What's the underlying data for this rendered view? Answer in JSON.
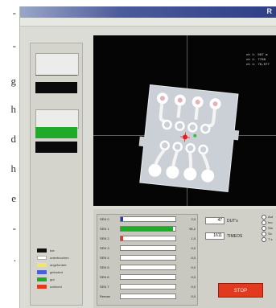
{
  "side_text": [
    "-",
    "-",
    "g",
    "h",
    "d",
    "h",
    "e",
    "-",
    "."
  ],
  "window": {
    "title": "R"
  },
  "colors": {
    "title_gradient_start": "#9aa6c8",
    "title_gradient_end": "#2f3f86",
    "camera_bg": "#050505",
    "chip_body": "#cbd0d6",
    "pad": "#ffffff",
    "accent_green": "#1faa2a",
    "stop_red": "#e23a1e"
  },
  "camera": {
    "overlay_lines": [
      "ch 1: 097 m",
      "ch 1: 7768",
      "ch 1: 76,077"
    ]
  },
  "legend": [
    {
      "label": "bar",
      "color": "#111111"
    },
    {
      "label": "unterbrochen",
      "color": "#ffffff"
    },
    {
      "label": "angefordert",
      "color": "#f2e66a"
    },
    {
      "label": "gefordert",
      "color": "#4a5fd0"
    },
    {
      "label": "gut",
      "color": "#1faa2a"
    },
    {
      "label": "schlecht",
      "color": "#e23a1e"
    }
  ],
  "channels": [
    {
      "label": "SEN 0",
      "value": "2,0",
      "level": 0.02,
      "color": "#2a3c9c"
    },
    {
      "label": "SEN 1",
      "value": "96,2",
      "level": 0.96,
      "color": "#1faa2a"
    },
    {
      "label": "SEN 2",
      "value": "1,0",
      "level": 0.01,
      "color": "#e23a1e"
    },
    {
      "label": "SEN 3",
      "value": "0,0",
      "level": 0.0,
      "color": "#2a3c9c"
    },
    {
      "label": "SEN 4",
      "value": "0,0",
      "level": 0.0,
      "color": "#2a3c9c"
    },
    {
      "label": "SEN 5",
      "value": "0,0",
      "level": 0.0,
      "color": "#2a3c9c"
    },
    {
      "label": "SEN 6",
      "value": "0,0",
      "level": 0.0,
      "color": "#2a3c9c"
    },
    {
      "label": "SEN 7",
      "value": "0,0",
      "level": 0.0,
      "color": "#2a3c9c"
    },
    {
      "label": "Reman",
      "value": "0,0",
      "level": 0.0,
      "color": "#2a3c9c"
    }
  ],
  "params": [
    {
      "value": "47",
      "label": "DUT's"
    },
    {
      "value": "1611",
      "label": "TIMEOS"
    }
  ],
  "radios": [
    "Aut",
    "Ino",
    "Sto",
    "So",
    "T s"
  ],
  "stop_label": "STOP"
}
